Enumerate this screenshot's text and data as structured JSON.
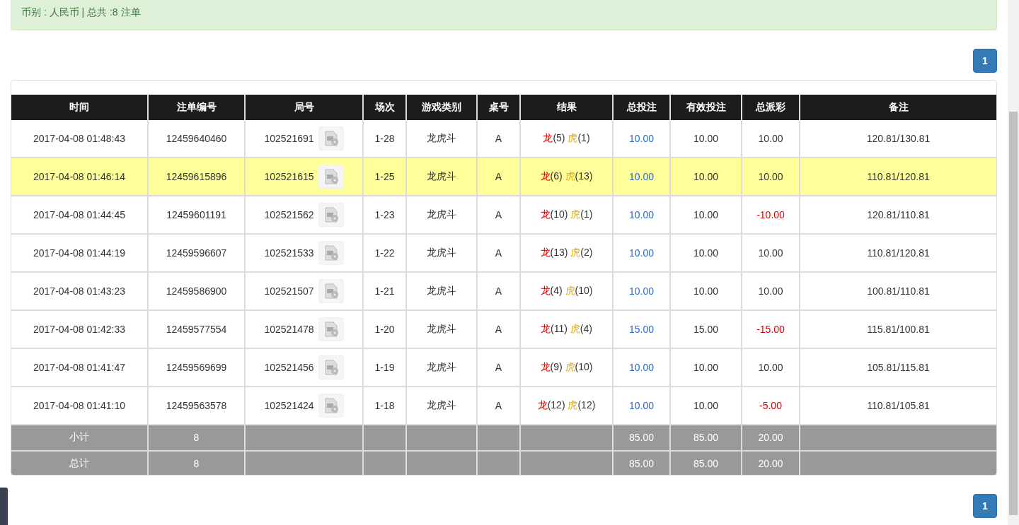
{
  "summary": "币别 : 人民币 | 总共 :8 注单",
  "pagination_top": [
    {
      "label": "1",
      "selected": true
    }
  ],
  "table": {
    "columns": [
      "时间",
      "注单编号",
      "局号",
      "场次",
      "游戏类别",
      "桌号",
      "结果",
      "总投注",
      "有效投注",
      "总派彩",
      "备注"
    ],
    "rows": [
      {
        "time": "2017-04-08 01:48:43",
        "bet_id": "12459640460",
        "round": "102521691",
        "game_no": "1-28",
        "game": "龙虎斗",
        "table": "A",
        "result": {
          "dragon": "龙",
          "dragon_value": "(5)",
          "tiger": "虎",
          "tiger_value": "(1)"
        },
        "bet": "10.00",
        "valid_bet": "10.00",
        "payout": "10.00",
        "negative": false,
        "note": "120.81/130.81",
        "selected": false
      },
      {
        "time": "2017-04-08 01:46:14",
        "bet_id": "12459615896",
        "round": "102521615",
        "game_no": "1-25",
        "game": "龙虎斗",
        "table": "A",
        "result": {
          "dragon": "龙",
          "dragon_value": "(6)",
          "tiger": "虎",
          "tiger_value": "(13)"
        },
        "bet": "10.00",
        "valid_bet": "10.00",
        "payout": "10.00",
        "negative": false,
        "note": "110.81/120.81",
        "selected": true
      },
      {
        "time": "2017-04-08 01:44:45",
        "bet_id": "12459601191",
        "round": "102521562",
        "game_no": "1-23",
        "game": "龙虎斗",
        "table": "A",
        "result": {
          "dragon": "龙",
          "dragon_value": "(10)",
          "tiger": "虎",
          "tiger_value": "(1)"
        },
        "bet": "10.00",
        "valid_bet": "10.00",
        "payout": "-10.00",
        "negative": true,
        "note": "120.81/110.81",
        "selected": false
      },
      {
        "time": "2017-04-08 01:44:19",
        "bet_id": "12459596607",
        "round": "102521533",
        "game_no": "1-22",
        "game": "龙虎斗",
        "table": "A",
        "result": {
          "dragon": "龙",
          "dragon_value": "(13)",
          "tiger": "虎",
          "tiger_value": "(2)"
        },
        "bet": "10.00",
        "valid_bet": "10.00",
        "payout": "10.00",
        "negative": false,
        "note": "110.81/120.81",
        "selected": false
      },
      {
        "time": "2017-04-08 01:43:23",
        "bet_id": "12459586900",
        "round": "102521507",
        "game_no": "1-21",
        "game": "龙虎斗",
        "table": "A",
        "result": {
          "dragon": "龙",
          "dragon_value": "(4)",
          "tiger": "虎",
          "tiger_value": "(10)"
        },
        "bet": "10.00",
        "valid_bet": "10.00",
        "payout": "10.00",
        "negative": false,
        "note": "100.81/110.81",
        "selected": false
      },
      {
        "time": "2017-04-08 01:42:33",
        "bet_id": "12459577554",
        "round": "102521478",
        "game_no": "1-20",
        "game": "龙虎斗",
        "table": "A",
        "result": {
          "dragon": "龙",
          "dragon_value": "(11)",
          "tiger": "虎",
          "tiger_value": "(4)"
        },
        "bet": "15.00",
        "valid_bet": "15.00",
        "payout": "-15.00",
        "negative": true,
        "note": "115.81/100.81",
        "selected": false
      },
      {
        "time": "2017-04-08 01:41:47",
        "bet_id": "12459569699",
        "round": "102521456",
        "game_no": "1-19",
        "game": "龙虎斗",
        "table": "A",
        "result": {
          "dragon": "龙",
          "dragon_value": "(9)",
          "tiger": "虎",
          "tiger_value": "(10)"
        },
        "bet": "10.00",
        "valid_bet": "10.00",
        "payout": "10.00",
        "negative": false,
        "note": "105.81/115.81",
        "selected": false
      },
      {
        "time": "2017-04-08 01:41:10",
        "bet_id": "12459563578",
        "round": "102521424",
        "game_no": "1-18",
        "game": "龙虎斗",
        "table": "A",
        "result": {
          "dragon": "龙",
          "dragon_value": "(12)",
          "tiger": "虎",
          "tiger_value": "(12)"
        },
        "bet": "10.00",
        "valid_bet": "10.00",
        "payout": "-5.00",
        "negative": true,
        "note": "110.81/105.81",
        "selected": false
      }
    ],
    "totals": [
      {
        "label": "小计",
        "count": "8",
        "bet": "85.00",
        "valid_bet": "85.00",
        "payout": "20.00"
      },
      {
        "label": "总计",
        "count": "8",
        "bet": "85.00",
        "valid_bet": "85.00",
        "payout": "20.00"
      }
    ]
  },
  "pagination_bottom": [
    {
      "label": "1",
      "selected": true
    }
  ]
}
